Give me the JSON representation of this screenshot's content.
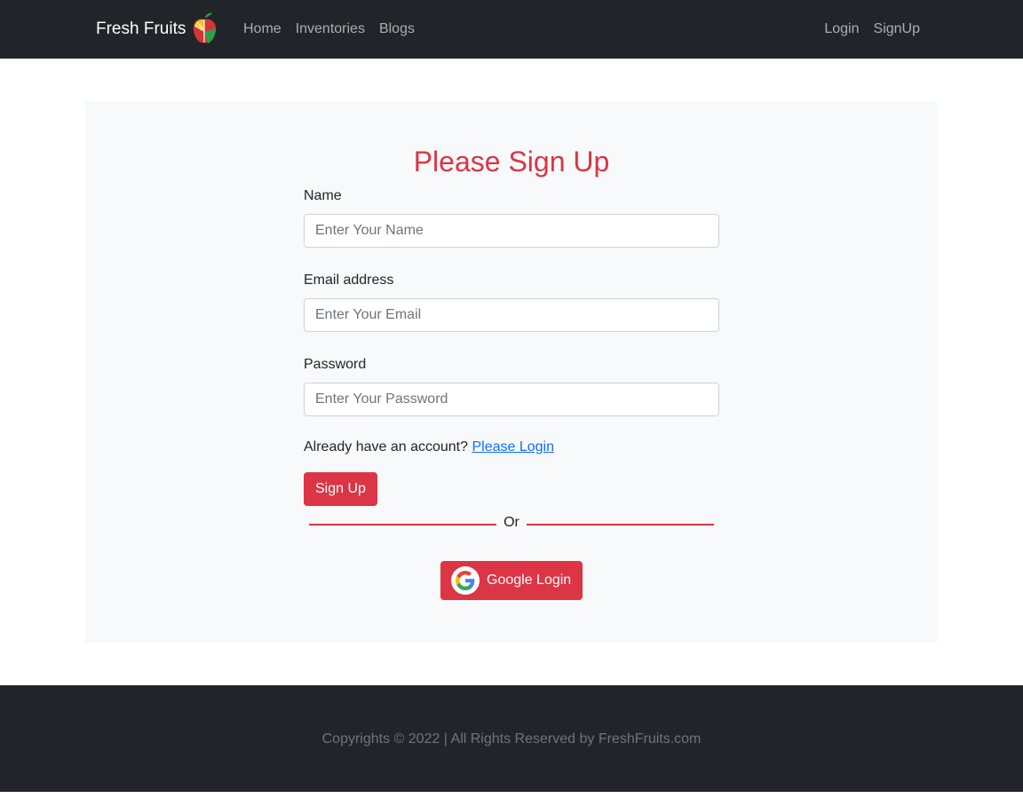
{
  "navbar": {
    "brand": "Fresh Fruits",
    "logo_icon": "fruit-logo-icon",
    "left_links": [
      "Home",
      "Inventories",
      "Blogs"
    ],
    "right_links": [
      "Login",
      "SignUp"
    ]
  },
  "form": {
    "title": "Please Sign Up",
    "name_label": "Name",
    "name_placeholder": "Enter Your Name",
    "email_label": "Email address",
    "email_placeholder": "Enter Your Email",
    "password_label": "Password",
    "password_placeholder": "Enter Your Password",
    "account_prompt": "Already have an account?",
    "login_link": "Please Login",
    "submit_label": "Sign Up",
    "divider_text": "Or",
    "google_label": "Google Login",
    "google_icon": "google-icon"
  },
  "footer": {
    "text": "Copyrights © 2022 | All Rights Reserved by FreshFruits.com"
  },
  "colors": {
    "accent": "#dc3545",
    "dark": "#212529",
    "panel": "#f8f9fa",
    "link": "#0d6efd"
  }
}
